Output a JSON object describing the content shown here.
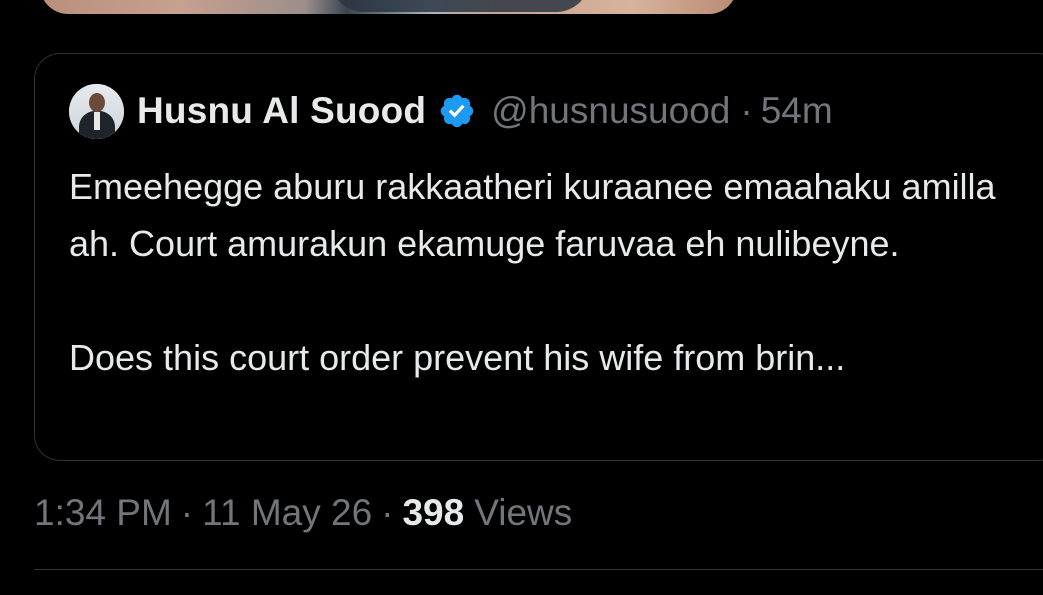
{
  "quoted_tweet": {
    "author_name": "Husnu Al Suood",
    "handle": "@husnusuood",
    "separator": "·",
    "time_ago": "54m",
    "verified": true,
    "text_line1": "Emeehegge aburu rakkaatheri kuraanee emaahaku amilla ah. Court amurakun ekamuge faruvaa eh nulibeyne.",
    "text_line2": "Does this court order prevent his wife from brin..."
  },
  "meta": {
    "time": "1:34 PM",
    "separator": "·",
    "date": "11 May 26",
    "views_count": "398",
    "views_label": "Views"
  },
  "colors": {
    "background": "#000000",
    "primary_text": "#e7e9ea",
    "secondary_text": "#71767b",
    "border": "#2f3336",
    "verified_blue": "#1d9bf0"
  }
}
